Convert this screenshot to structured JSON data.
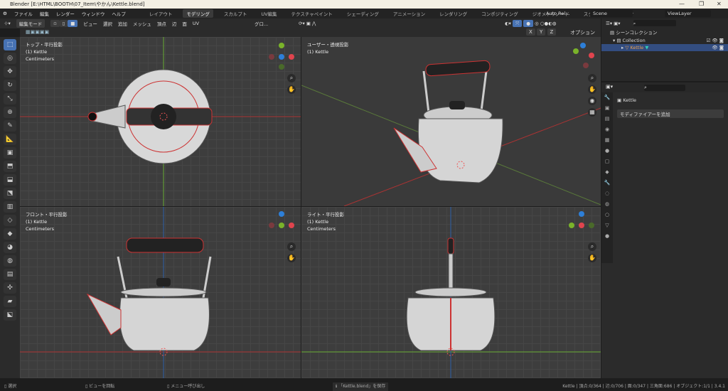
{
  "window": {
    "title": "Blender [E:\\HTML\\BOOTH\\07_Item\\やかん\\Kettle.blend]",
    "minimize": "—",
    "maximize": "❐",
    "close": "✕"
  },
  "menu": [
    "ファイル",
    "編集",
    "レンダー",
    "ウィンドウ",
    "ヘルプ"
  ],
  "workspaces": [
    "レイアウト",
    "モデリング",
    "スカルプト",
    "UV編集",
    "テクスチャペイント",
    "シェーディング",
    "アニメーション",
    "レンダリング",
    "コンポジティング",
    "ジオメトリノード",
    "スクリプト作成",
    "+"
  ],
  "active_workspace": "モデリング",
  "topright": {
    "auto_run": "Auto Rel...",
    "scene": "Scene",
    "view_layer": "ViewLayer"
  },
  "header": {
    "mode": "編集モード",
    "menus": [
      "ビュー",
      "選択",
      "追加",
      "メッシュ",
      "頂点",
      "辺",
      "面",
      "UV"
    ],
    "transform": "グロ...",
    "axes": [
      "X",
      "Y",
      "Z"
    ],
    "options": "オプション"
  },
  "viewports": [
    {
      "view": "トップ・平行投影",
      "object": "(1) Kettle",
      "units": "Centimeters"
    },
    {
      "view": "ユーザー・透視投影",
      "object": "(1) Kettle",
      "units": ""
    },
    {
      "view": "フロント・平行投影",
      "object": "(1) Kettle",
      "units": "Centimeters"
    },
    {
      "view": "ライト・平行投影",
      "object": "(1) Kettle",
      "units": "Centimeters"
    }
  ],
  "outliner": {
    "scene_collection": "シーンコレクション",
    "collection": "Collection",
    "object": "Kettle"
  },
  "properties": {
    "object": "Kettle",
    "add_modifier": "モディファイアーを追加"
  },
  "status": {
    "select": "選択",
    "rotate": "ビューを回転",
    "menu": "メニュー呼び出し",
    "saved": "「Kettle.blend」を保存",
    "stats": "Kettle | 頂点:0/364 | 辺:0/706 | 面:0/347 | 三角面:686 | オブジェクト:1/1 | 3.4.1"
  },
  "colors": {
    "accent": "#4772b3",
    "x": "#e0444e",
    "y": "#7ab32a",
    "z": "#2d7fd8",
    "selected_edge": "#e03030"
  }
}
